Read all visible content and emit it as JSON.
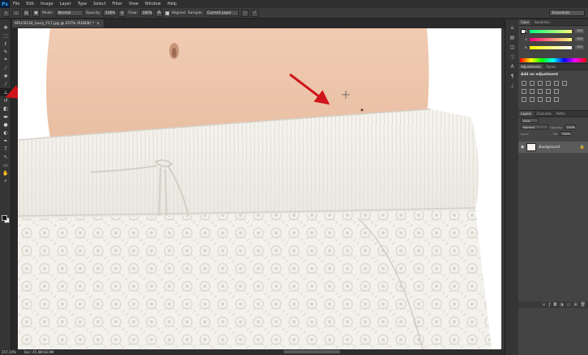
{
  "app": {
    "logo": "Ps"
  },
  "menu": [
    "File",
    "Edit",
    "Image",
    "Layer",
    "Type",
    "Select",
    "Filter",
    "View",
    "Window",
    "Help"
  ],
  "options": {
    "mode_label": "Mode:",
    "mode_value": "Normal",
    "opacity_label": "Opacity:",
    "opacity_value": "100%",
    "flow_label": "Flow:",
    "flow_value": "100%",
    "aligned_label": "Aligned",
    "sample_label": "Sample:",
    "sample_value": "Current Layer",
    "workspace": "Essentials"
  },
  "document": {
    "tab_title": "6PLC8234_Ivory_F17.jpg @ 257% (RGB/8) *",
    "close": "×"
  },
  "status": {
    "zoom": "257.24%",
    "doc_size": "Doc: 45.4M/38.9M"
  },
  "tools": [
    {
      "name": "move-tool",
      "glyph": "✥"
    },
    {
      "name": "marquee-tool",
      "glyph": "⬚"
    },
    {
      "name": "lasso-tool",
      "glyph": "ℓ"
    },
    {
      "name": "quick-select-tool",
      "glyph": "✎"
    },
    {
      "name": "crop-tool",
      "glyph": "⌗"
    },
    {
      "name": "eyedropper-tool",
      "glyph": "⁄"
    },
    {
      "name": "healing-brush-tool",
      "glyph": "✚"
    },
    {
      "name": "brush-tool",
      "glyph": "⁄"
    },
    {
      "name": "clone-stamp-tool",
      "glyph": "⊥"
    },
    {
      "name": "history-brush-tool",
      "glyph": "↺"
    },
    {
      "name": "eraser-tool",
      "glyph": "◧"
    },
    {
      "name": "gradient-tool",
      "glyph": "▬"
    },
    {
      "name": "blur-tool",
      "glyph": "●"
    },
    {
      "name": "dodge-tool",
      "glyph": "◐"
    },
    {
      "name": "pen-tool",
      "glyph": "✒"
    },
    {
      "name": "type-tool",
      "glyph": "T"
    },
    {
      "name": "path-select-tool",
      "glyph": "↖"
    },
    {
      "name": "shape-tool",
      "glyph": "▭"
    },
    {
      "name": "hand-tool",
      "glyph": "✋"
    },
    {
      "name": "zoom-tool",
      "glyph": "⌕"
    }
  ],
  "panels": {
    "color_tabs": [
      "Color",
      "Swatches"
    ],
    "color": {
      "r_label": "R",
      "g_label": "G",
      "b_label": "B",
      "r": "255",
      "g": "250",
      "b": "124"
    },
    "adj_tabs": [
      "Adjustments",
      "Styles"
    ],
    "adj_title": "Add an adjustment",
    "layers_tabs": [
      "Layers",
      "Channels",
      "Paths"
    ],
    "layers": {
      "kind_label": "Kind",
      "blend": "Normal",
      "opacity_label": "Opacity:",
      "opacity": "100%",
      "lock_label": "Lock:",
      "fill_label": "Fill:",
      "fill": "100%",
      "layer_name": "Background"
    }
  },
  "colors": {
    "accent_arrow": "#d0141b",
    "canvas_bg": "#ffffff",
    "skin": "#f2cdb4"
  }
}
